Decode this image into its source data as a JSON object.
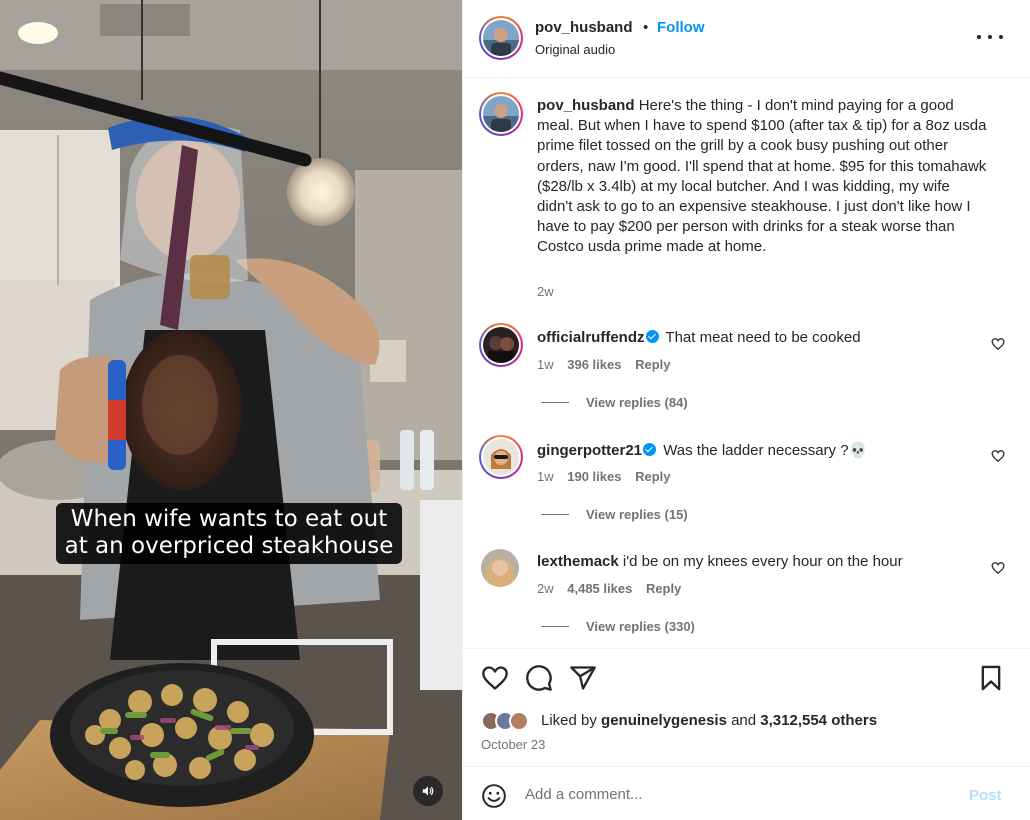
{
  "media": {
    "caption_line1": "When wife wants to eat out",
    "caption_line2": "at an overpriced steakhouse",
    "audio_icon": "speaker-icon"
  },
  "header": {
    "username": "pov_husband",
    "separator": "•",
    "follow_label": "Follow",
    "audio_label": "Original audio",
    "more_icon": "more-options-icon"
  },
  "post_caption": {
    "username": "pov_husband",
    "text": "Here's the thing - I don't mind paying for a good meal. But when I have to spend $100 (after tax & tip) for a 8oz usda prime filet tossed on the grill by a cook busy pushing out other orders, naw I'm good. I'll spend that at home. $95 for this tomahawk ($28/lb x 3.4lb) at my local butcher. And I was kidding, my wife didn't ask to go to an expensive steakhouse. I just don't like how I have to pay $200 per person with drinks for a steak worse than Costco usda prime made at home.",
    "time": "2w"
  },
  "comments": [
    {
      "username": "officialruffendz",
      "verified": true,
      "text": "That meat need to be cooked",
      "time": "1w",
      "likes": "396 likes",
      "reply_label": "Reply",
      "view_replies": "View replies (84)"
    },
    {
      "username": "gingerpotter21",
      "verified": true,
      "text": "Was the ladder necessary ?💀",
      "time": "1w",
      "likes": "190 likes",
      "reply_label": "Reply",
      "view_replies": "View replies (15)"
    },
    {
      "username": "lexthemack",
      "verified": false,
      "text": "i'd be on my knees every hour on the hour",
      "time": "2w",
      "likes": "4,485 likes",
      "reply_label": "Reply",
      "view_replies": "View replies (330)"
    }
  ],
  "actions": {
    "like_icon": "heart-icon",
    "comment_icon": "comment-icon",
    "share_icon": "share-icon",
    "save_icon": "bookmark-icon",
    "liked_by_prefix": "Liked by",
    "liked_by_user": "genuinelygenesis",
    "liked_by_and": "and",
    "liked_by_others": "3,312,554 others",
    "date": "October 23"
  },
  "add_comment": {
    "emoji_icon": "emoji-icon",
    "placeholder": "Add a comment...",
    "post_label": "Post"
  },
  "colors": {
    "link_blue": "#0095f6",
    "post_disabled": "#b2dffc",
    "text_primary": "#262626",
    "text_secondary": "#737373"
  }
}
